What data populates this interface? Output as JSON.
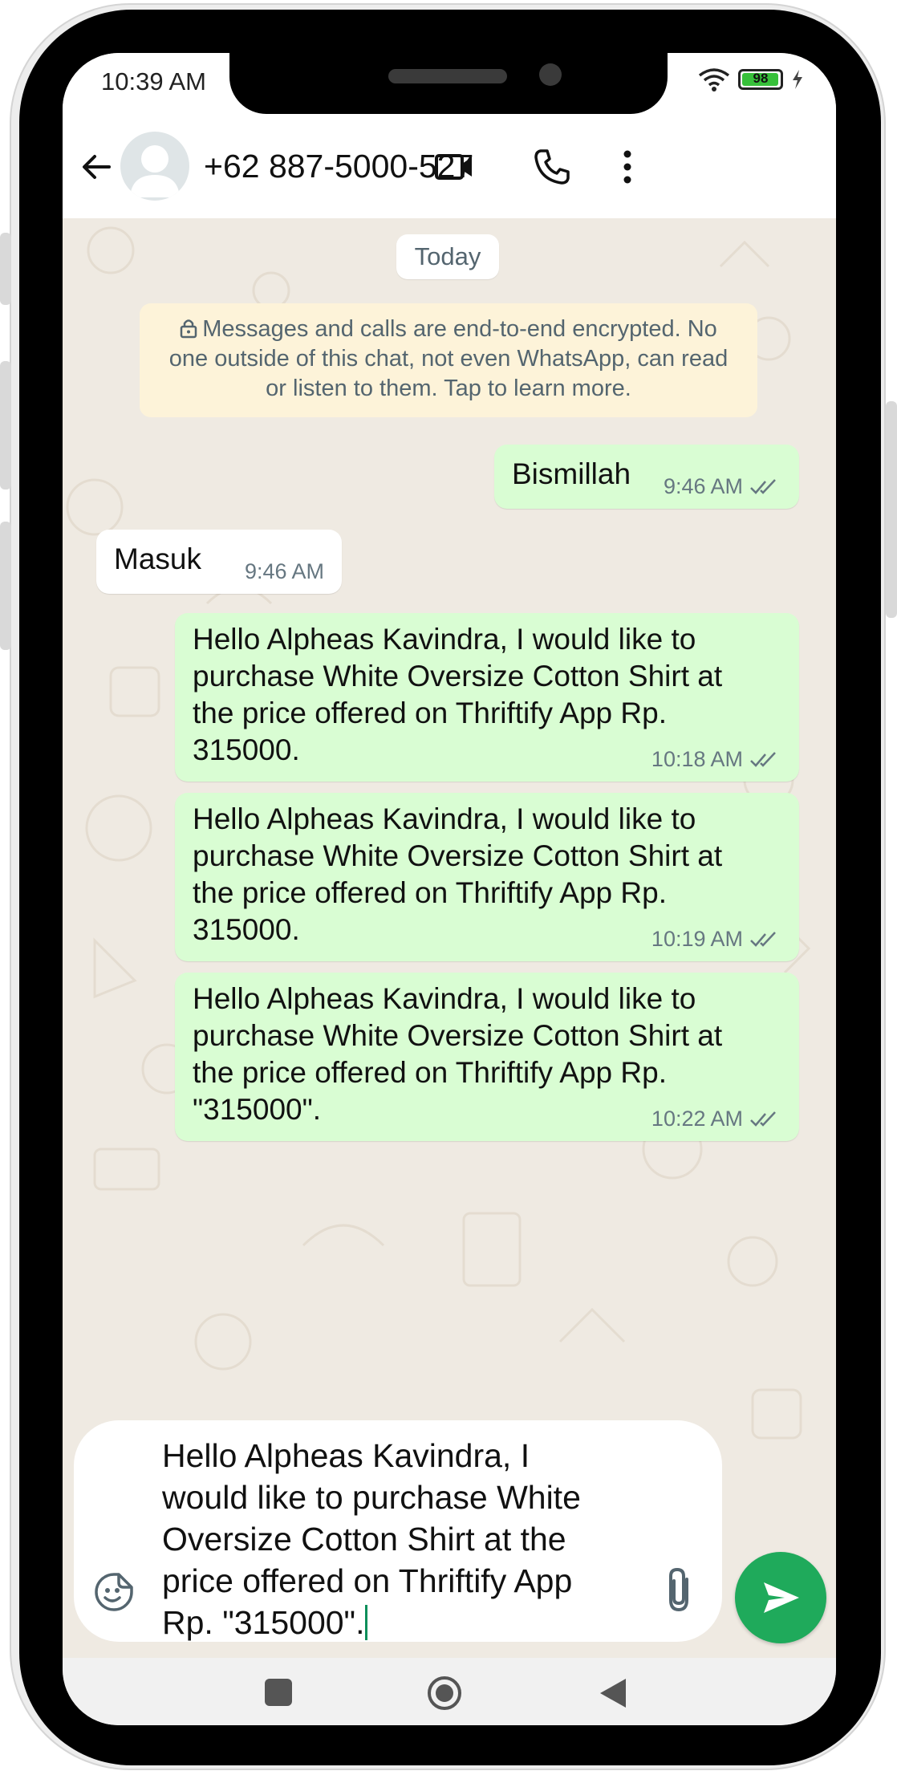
{
  "status_bar": {
    "time": "10:39 AM",
    "battery_level": "98",
    "battery_fraction": 0.98,
    "icons": [
      "wifi-icon",
      "battery-icon",
      "charging-bolt-icon"
    ]
  },
  "header": {
    "contact_name": "+62 887-5000-527",
    "icons": [
      "back-arrow-icon",
      "avatar",
      "video-call-icon",
      "voice-call-icon",
      "more-options-icon"
    ]
  },
  "chat": {
    "date_chip": "Today",
    "encryption_note": "Messages and calls are end-to-end encrypted. No one outside of this chat, not even WhatsApp, can read or listen to them. Tap to learn more.",
    "messages": [
      {
        "direction": "out",
        "text": "Bismillah",
        "time": "9:46 AM",
        "status": "read"
      },
      {
        "direction": "in",
        "text": "Masuk",
        "time": "9:46 AM"
      },
      {
        "direction": "out",
        "text": "Hello Alpheas Kavindra, I would like to\npurchase White Oversize Cotton Shirt at\nthe price offered on Thriftify App Rp.\n315000.",
        "time": "10:18 AM",
        "status": "read"
      },
      {
        "direction": "out",
        "text": "Hello Alpheas Kavindra, I would like to\npurchase White Oversize Cotton Shirt at\nthe price offered on Thriftify App Rp.\n315000.",
        "time": "10:19 AM",
        "status": "read"
      },
      {
        "direction": "out",
        "text": "Hello Alpheas Kavindra, I would like to\npurchase White Oversize Cotton Shirt at\nthe price offered on Thriftify App Rp.\n\"315000\".",
        "time": "10:22 AM",
        "status": "read"
      }
    ]
  },
  "composer": {
    "value": "Hello Alpheas Kavindra, I\nwould like to purchase White\nOversize Cotton Shirt at the\nprice offered on Thriftify App\nRp. \"315000\".",
    "icons": [
      "emoji-sticker-icon",
      "attach-paperclip-icon",
      "send-icon"
    ]
  },
  "nav_bar": {
    "icons": [
      "recent-apps-icon",
      "home-icon",
      "back-icon"
    ]
  },
  "colors": {
    "outgoing_bubble": "#d9fdd3",
    "incoming_bubble": "#ffffff",
    "send_button": "#1faa5b",
    "encryption_note_bg": "#fdf3d9",
    "chat_background": "#efeae2"
  }
}
